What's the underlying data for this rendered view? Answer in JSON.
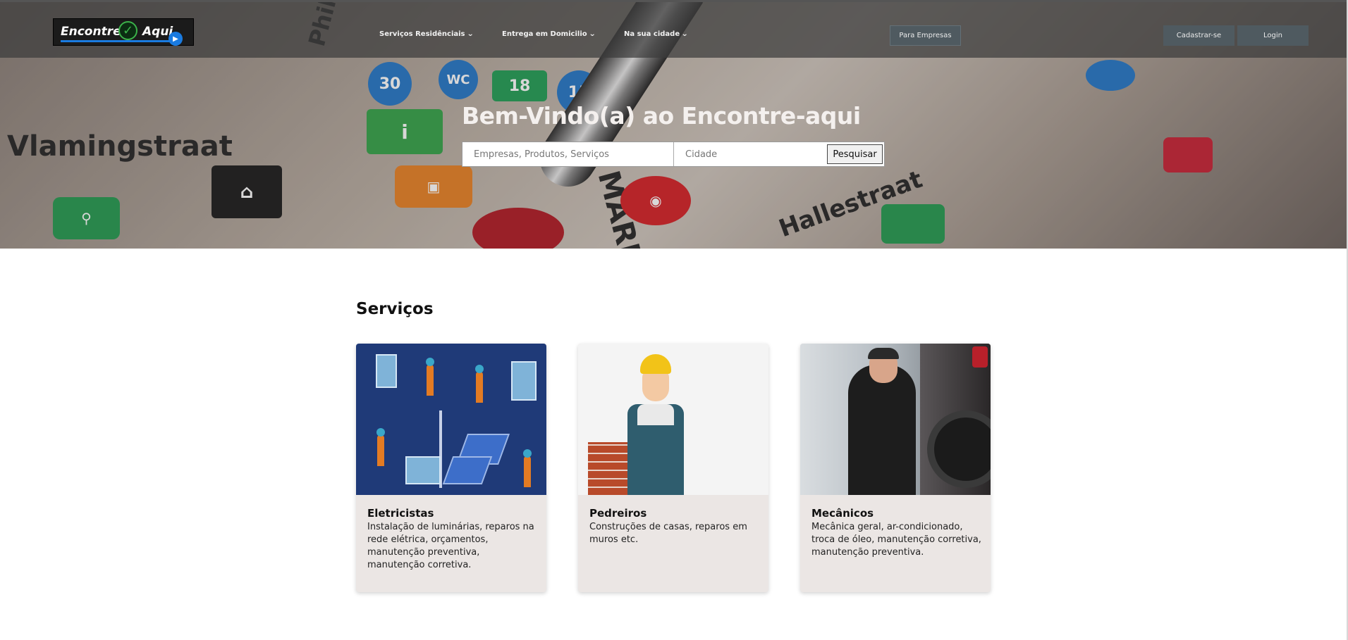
{
  "navbar": {
    "logo": {
      "word1": "Encontre",
      "word2": "Aqui"
    },
    "menu": [
      {
        "label": "Serviços Residênciais"
      },
      {
        "label": "Entrega em Domicilio"
      },
      {
        "label": "Na sua cidade"
      }
    ],
    "for_business_label": "Para Empresas",
    "signup_label": "Cadastrar-se",
    "login_label": "Login"
  },
  "hero": {
    "title": "Bem-Vindo(a) ao Encontre-aqui",
    "search": {
      "query_placeholder": "Empresas, Produtos, Serviços",
      "city_placeholder": "Cidade",
      "submit_label": "Pesquisar"
    }
  },
  "services": {
    "title": "Serviços",
    "cards": [
      {
        "name": "Eletricistas",
        "description": "Instalação de luminárias, reparos na rede elétrica, orçamentos, manutenção preventiva, manutenção corretiva."
      },
      {
        "name": "Pedreiros",
        "description": "Construções de casas, reparos em muros etc."
      },
      {
        "name": "Mecânicos",
        "description": "Mecânica geral, ar-condicionado, troca de óleo, manutenção corretiva, manutenção preventiva."
      }
    ]
  }
}
